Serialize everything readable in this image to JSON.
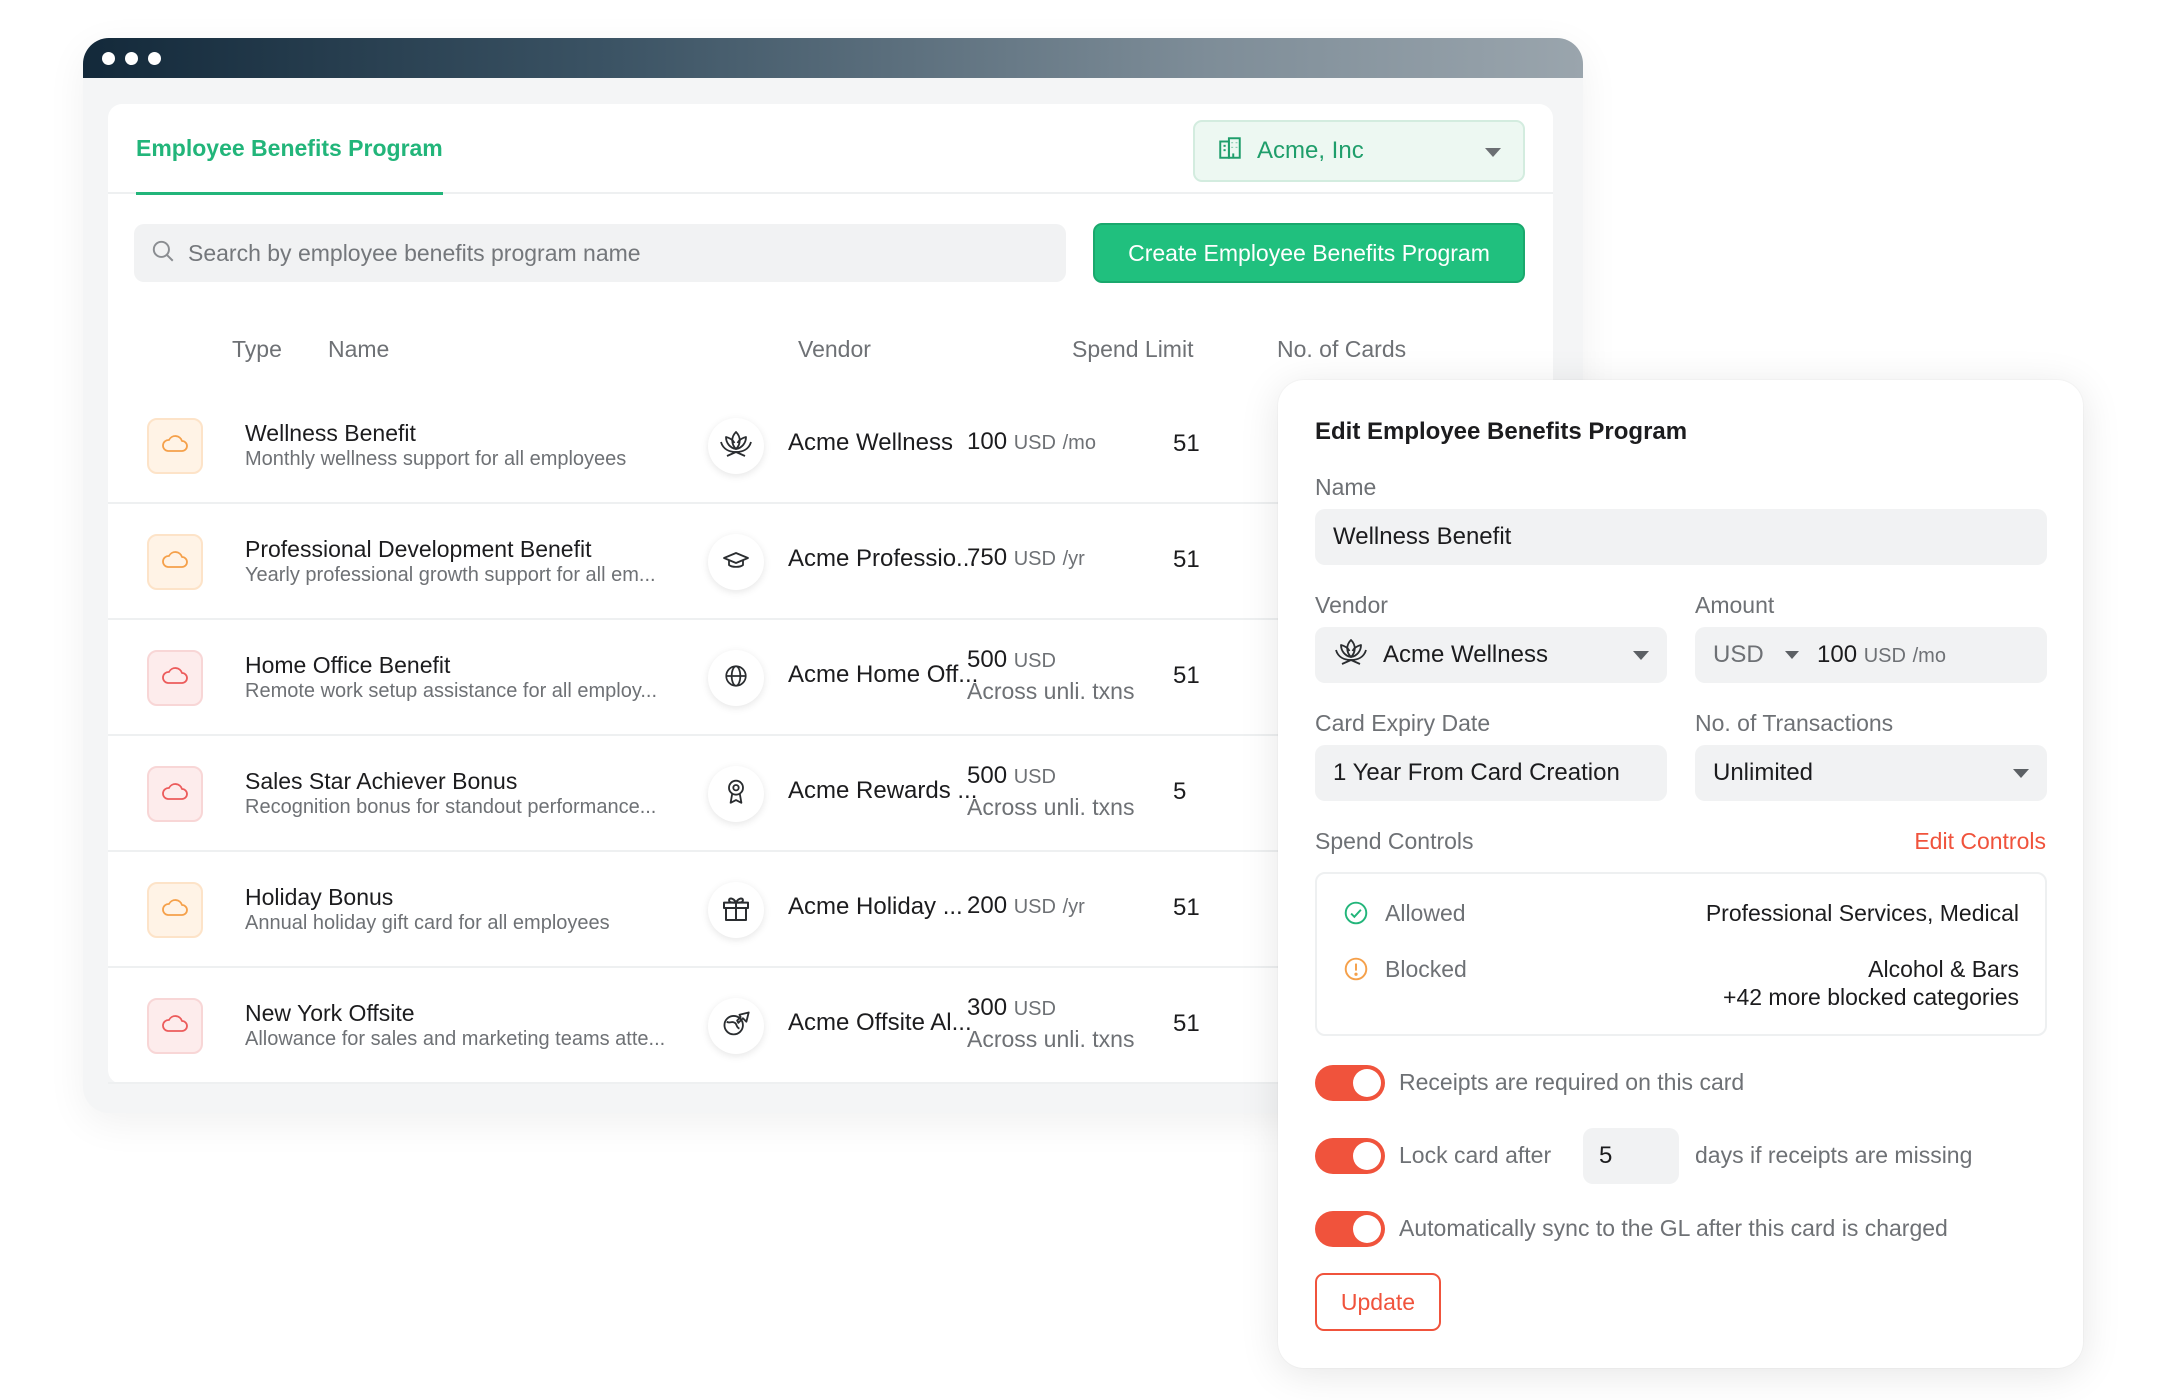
{
  "window": {
    "tab_label": "Employee Benefits Program"
  },
  "org_select": {
    "value": "Acme, Inc"
  },
  "search": {
    "placeholder": "Search by employee benefits program name"
  },
  "create_button": {
    "label": "Create Employee Benefits Program"
  },
  "table": {
    "headers": {
      "type": "Type",
      "name": "Name",
      "vendor": "Vendor",
      "spend_limit": "Spend Limit",
      "cards": "No. of Cards"
    },
    "rows": [
      {
        "type_icon": "cloud-icon",
        "type_color": "orange",
        "name": "Wellness Benefit",
        "description": "Monthly wellness support for all employees",
        "vendor": "Acme Wellness",
        "vendor_icon": "lotus-icon",
        "amount": "100",
        "unit": "USD",
        "period": "/mo",
        "limit_note": "",
        "cards": "51"
      },
      {
        "type_icon": "cloud-icon",
        "type_color": "orange",
        "name": "Professional Development Benefit",
        "description": "Yearly professional growth support for all em...",
        "vendor": "Acme Professio...",
        "vendor_icon": "graduation-cap-icon",
        "amount": "750",
        "unit": "USD",
        "period": "/yr",
        "limit_note": "",
        "cards": "51"
      },
      {
        "type_icon": "cloud-icon",
        "type_color": "red",
        "name": "Home Office Benefit",
        "description": "Remote work setup assistance for all employ...",
        "vendor": "Acme Home Off...",
        "vendor_icon": "globe-icon",
        "amount": "500",
        "unit": "USD",
        "period": "",
        "limit_note": "Across unli. txns",
        "cards": "51"
      },
      {
        "type_icon": "cloud-icon",
        "type_color": "red",
        "name": "Sales Star Achiever Bonus",
        "description": "Recognition bonus for standout performance...",
        "vendor": "Acme Rewards ...",
        "vendor_icon": "award-icon",
        "amount": "500",
        "unit": "USD",
        "period": "",
        "limit_note": "Across unli. txns",
        "cards": "5"
      },
      {
        "type_icon": "cloud-icon",
        "type_color": "orange",
        "name": "Holiday Bonus",
        "description": "Annual holiday gift card for all employees",
        "vendor": "Acme Holiday ...",
        "vendor_icon": "gift-icon",
        "amount": "200",
        "unit": "USD",
        "period": "/yr",
        "limit_note": "",
        "cards": "51"
      },
      {
        "type_icon": "cloud-icon",
        "type_color": "red",
        "name": "New York Offsite",
        "description": "Allowance for sales and marketing teams atte...",
        "vendor": "Acme Offsite Al...",
        "vendor_icon": "airplane-globe-icon",
        "amount": "300",
        "unit": "USD",
        "period": "",
        "limit_note": "Across unli. txns",
        "cards": "51"
      }
    ]
  },
  "edit": {
    "title": "Edit Employee Benefits Program",
    "name_label": "Name",
    "name_value": "Wellness Benefit",
    "vendor_label": "Vendor",
    "vendor_value": "Acme Wellness",
    "amount_label": "Amount",
    "currency": "USD",
    "amount_value": "100",
    "amount_unit": "USD",
    "amount_period": "/mo",
    "expiry_label": "Card Expiry Date",
    "expiry_value": "1 Year From Card Creation",
    "transactions_label": "No. of Transactions",
    "transactions_value": "Unlimited",
    "spend_controls_label": "Spend Controls",
    "edit_controls_label": "Edit Controls",
    "allowed_label": "Allowed",
    "allowed_value": "Professional Services, Medical",
    "blocked_label": "Blocked",
    "blocked_value": "Alcohol & Bars",
    "blocked_more": "+42 more blocked categories",
    "receipts_text": "Receipts are required on this card",
    "lock_prefix": "Lock card after",
    "lock_days": "5",
    "lock_suffix": "days if receipts are missing",
    "sync_text": "Automatically sync to the GL after this card is charged",
    "update_label": "Update"
  },
  "colors": {
    "green": "#20c07e",
    "orange_red": "#f0533c",
    "orange": "#f5a04a",
    "red": "#ec5b5b"
  }
}
